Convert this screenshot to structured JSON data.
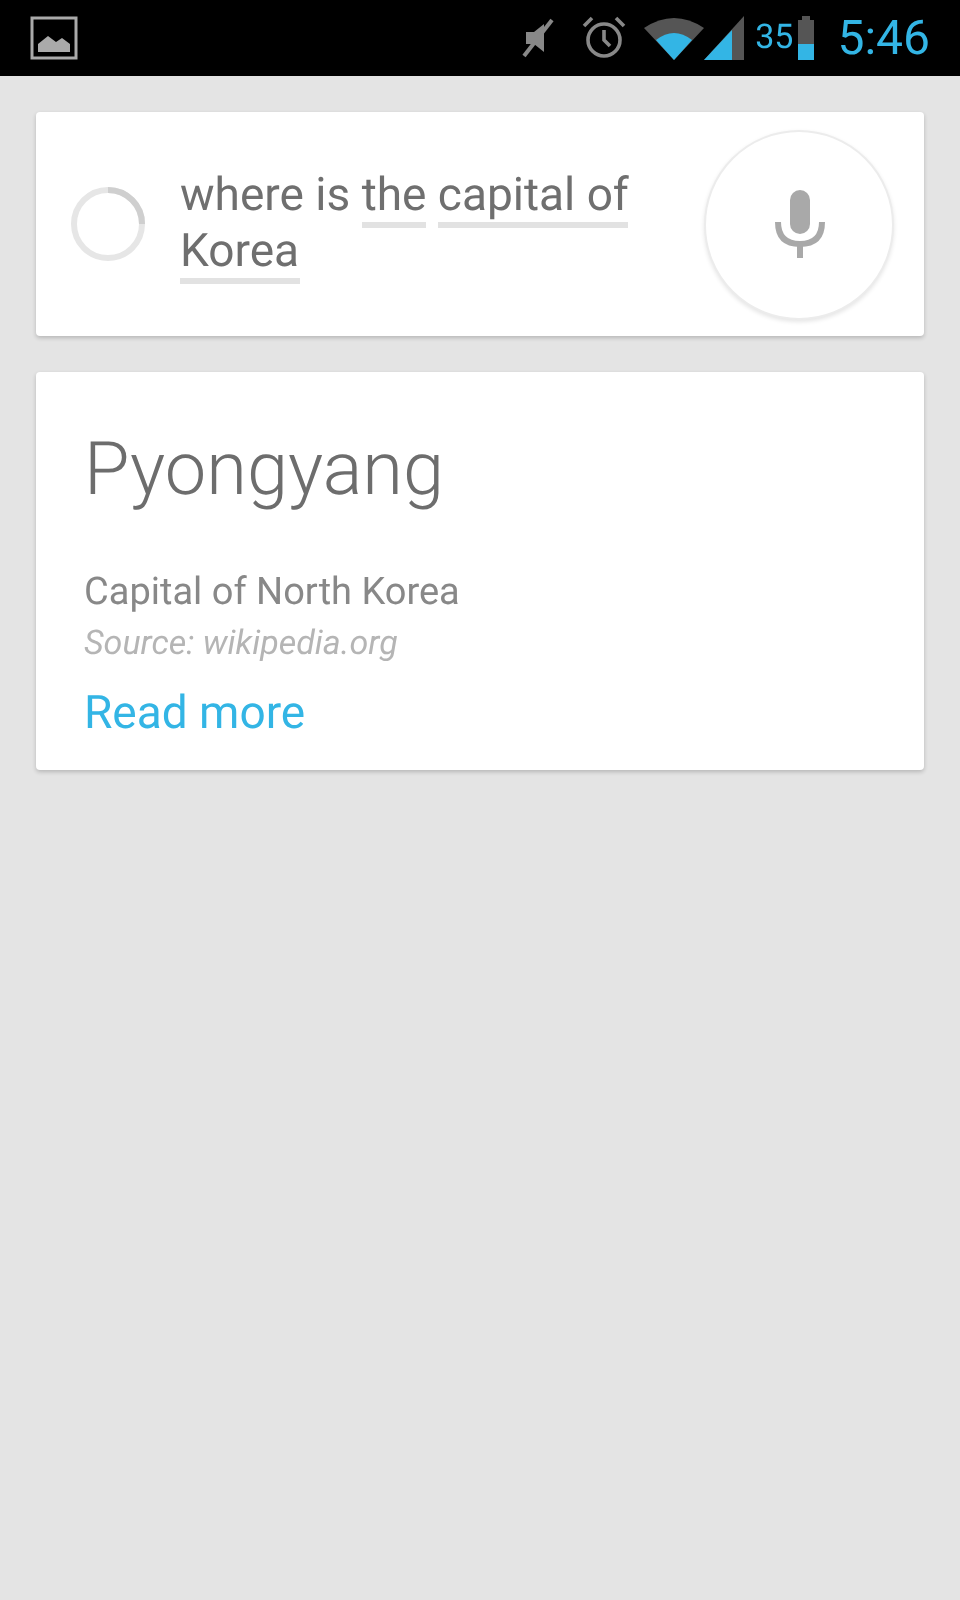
{
  "status_bar": {
    "battery_percent": "35",
    "time": "5:46"
  },
  "query": {
    "segments": [
      {
        "text": "where is",
        "underlined": false
      },
      {
        "text": "the",
        "underlined": true
      },
      {
        "text": "capital of",
        "underlined": true
      },
      {
        "text": "Korea",
        "underlined": true
      }
    ]
  },
  "answer": {
    "title": "Pyongyang",
    "description": "Capital of North Korea",
    "source": "Source: wikipedia.org",
    "link": "Read more"
  }
}
